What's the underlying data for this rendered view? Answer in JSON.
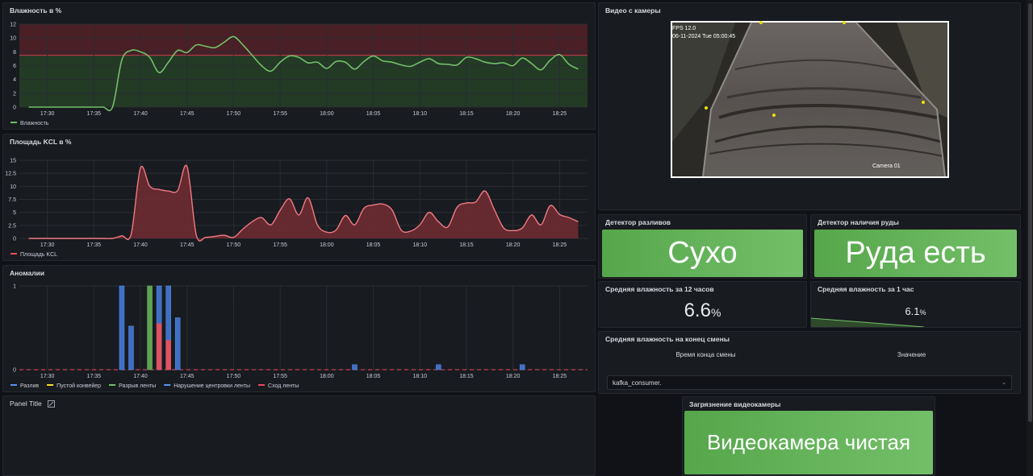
{
  "colors": {
    "bg": "#111217",
    "panel": "#181b1f",
    "green": "#73bf69",
    "red": "#f2495c",
    "blue": "#5794f2",
    "yellow": "#fade2a",
    "stat_bg": "#56a64b"
  },
  "humidity": {
    "title": "Влажность в %",
    "legend": "Влажность",
    "y_ticks": [
      "0",
      "2",
      "4",
      "6",
      "8",
      "10",
      "12"
    ],
    "x_ticks": [
      "17:30",
      "17:35",
      "17:40",
      "17:45",
      "17:50",
      "17:55",
      "18:00",
      "18:05",
      "18:10",
      "18:15",
      "18:20",
      "18:25"
    ]
  },
  "kcl": {
    "title": "Площадь KCL в %",
    "legend": "Площадь KCL",
    "y_ticks": [
      "0",
      "2.5",
      "5",
      "7.5",
      "10",
      "12.5",
      "15"
    ],
    "x_ticks": [
      "17:30",
      "17:35",
      "17:40",
      "17:45",
      "17:50",
      "17:55",
      "18:00",
      "18:05",
      "18:10",
      "18:15",
      "18:20",
      "18:25"
    ]
  },
  "anomalies": {
    "title": "Аномалии",
    "y_ticks": [
      "0",
      "1"
    ],
    "x_ticks": [
      "17:30",
      "17:35",
      "17:40",
      "17:45",
      "17:50",
      "17:55",
      "18:00",
      "18:05",
      "18:10",
      "18:15",
      "18:20",
      "18:25"
    ],
    "legend": [
      {
        "label": "Разлив",
        "color": "#5794f2"
      },
      {
        "label": "Пустой конвейер",
        "color": "#fade2a"
      },
      {
        "label": "Разрыв ленты",
        "color": "#73bf69"
      },
      {
        "label": "Нарушение центровки ленты",
        "color": "#5794f2"
      },
      {
        "label": "Сход ленты",
        "color": "#f2495c"
      }
    ]
  },
  "panel_title": {
    "title": "Panel Title"
  },
  "camera": {
    "title": "Видео с камеры",
    "osd_fps": "FPS 12.0",
    "osd_date": "06-11-2024 Tue 05:00:45",
    "osd_cam": "Camera 01"
  },
  "spill": {
    "title": "Детектор разливов",
    "value": "Сухо"
  },
  "ore": {
    "title": "Детектор наличия руды",
    "value": "Руда есть"
  },
  "avg12": {
    "title": "Средняя влажность за 12 часов",
    "value": "6.6",
    "unit": "%"
  },
  "avg1": {
    "title": "Средняя влажность за 1 час",
    "value": "6.1",
    "unit": "%"
  },
  "shift": {
    "title": "Средняя влажность на конец смены",
    "col_time": "Время конца смены",
    "col_value": "Значение",
    "select_value": "kafka_consumer."
  },
  "cam_dirt": {
    "title": "Загрязнение видеокамеры",
    "value": "Видеокамера чистая"
  },
  "chart_data": [
    {
      "type": "area",
      "title": "Влажность в %",
      "ylim": [
        0,
        12
      ],
      "x": [
        "17:28",
        "17:29",
        "17:30",
        "17:31",
        "17:32",
        "17:33",
        "17:34",
        "17:35",
        "17:36",
        "17:37",
        "17:38",
        "17:39",
        "17:40",
        "17:41",
        "17:42",
        "17:43",
        "17:44",
        "17:45",
        "17:46",
        "17:47",
        "17:48",
        "17:49",
        "17:50",
        "17:51",
        "17:52",
        "17:53",
        "17:54",
        "17:55",
        "17:56",
        "17:57",
        "17:58",
        "17:59",
        "18:00",
        "18:01",
        "18:02",
        "18:03",
        "18:04",
        "18:05",
        "18:06",
        "18:07",
        "18:08",
        "18:09",
        "18:10",
        "18:11",
        "18:12",
        "18:13",
        "18:14",
        "18:15",
        "18:16",
        "18:17",
        "18:18",
        "18:19",
        "18:20",
        "18:21",
        "18:22",
        "18:23",
        "18:24",
        "18:25",
        "18:26",
        "18:27"
      ],
      "series": [
        {
          "name": "Влажность",
          "values": [
            0,
            0,
            0,
            0,
            0,
            0,
            0,
            0,
            0,
            0,
            6.8,
            8.2,
            8.0,
            7.2,
            5.0,
            6.5,
            8.2,
            7.9,
            9.0,
            8.8,
            8.6,
            9.4,
            10.2,
            9.0,
            7.5,
            6.0,
            5.2,
            6.5,
            7.4,
            7.2,
            6.4,
            6.5,
            5.6,
            6.6,
            6.5,
            5.5,
            6.6,
            7.4,
            6.7,
            6.5,
            6.1,
            5.9,
            6.5,
            7.0,
            6.3,
            6.2,
            6.1,
            7.2,
            7.0,
            6.5,
            6.3,
            6.4,
            6.0,
            7.1,
            6.3,
            5.4,
            6.8,
            7.6,
            6.2,
            5.5
          ]
        }
      ],
      "threshold_ranges": [
        {
          "from": 0,
          "to": 7.5,
          "color": "green"
        },
        {
          "from": 7.5,
          "to": 12,
          "color": "red"
        }
      ]
    },
    {
      "type": "area",
      "title": "Площадь KCL в %",
      "ylim": [
        0,
        15
      ],
      "x": [
        "17:28",
        "17:29",
        "17:30",
        "17:31",
        "17:32",
        "17:33",
        "17:34",
        "17:35",
        "17:36",
        "17:37",
        "17:38",
        "17:39",
        "17:40",
        "17:41",
        "17:42",
        "17:43",
        "17:44",
        "17:45",
        "17:46",
        "17:47",
        "17:48",
        "17:49",
        "17:50",
        "17:51",
        "17:52",
        "17:53",
        "17:54",
        "17:55",
        "17:56",
        "17:57",
        "17:58",
        "17:59",
        "18:00",
        "18:01",
        "18:02",
        "18:03",
        "18:04",
        "18:05",
        "18:06",
        "18:07",
        "18:08",
        "18:09",
        "18:10",
        "18:11",
        "18:12",
        "18:13",
        "18:14",
        "18:15",
        "18:16",
        "18:17",
        "18:18",
        "18:19",
        "18:20",
        "18:21",
        "18:22",
        "18:23",
        "18:24",
        "18:25",
        "18:26",
        "18:27"
      ],
      "series": [
        {
          "name": "Площадь KCL",
          "values": [
            0,
            0,
            0,
            0,
            0,
            0,
            0,
            0,
            0,
            0,
            0.5,
            0.8,
            13.5,
            10.0,
            9.4,
            9.1,
            9.2,
            13.8,
            0.6,
            0.2,
            0.4,
            0.6,
            0.2,
            1.8,
            3.2,
            4.0,
            2.6,
            5.4,
            7.6,
            4.5,
            7.8,
            2.6,
            1.2,
            1.6,
            4.4,
            2.6,
            5.8,
            6.4,
            6.6,
            5.5,
            1.6,
            1.4,
            2.6,
            5.0,
            3.2,
            2.2,
            6.0,
            6.8,
            7.0,
            9.1,
            5.5,
            2.0,
            1.5,
            2.0,
            4.5,
            2.6,
            6.3,
            4.6,
            4.0,
            3.2
          ]
        }
      ]
    },
    {
      "type": "bar",
      "title": "Аномалии",
      "ylim": [
        0,
        1
      ],
      "series": [
        {
          "name": "Разлив",
          "points": [
            {
              "x": "17:38",
              "y": 1
            },
            {
              "x": "17:39",
              "y": 0.52
            },
            {
              "x": "17:41",
              "y": 1
            },
            {
              "x": "17:42",
              "y": 1
            },
            {
              "x": "17:43",
              "y": 1
            },
            {
              "x": "17:44",
              "y": 0.62
            },
            {
              "x": "18:03",
              "y": 0.06
            },
            {
              "x": "18:12",
              "y": 0.06
            },
            {
              "x": "18:21",
              "y": 0.06
            }
          ]
        },
        {
          "name": "Разрыв ленты",
          "points": [
            {
              "x": "17:41",
              "y": 1
            }
          ]
        },
        {
          "name": "Сход ленты",
          "points": [
            {
              "x": "17:42",
              "y": 0.55
            },
            {
              "x": "17:43",
              "y": 0.35
            }
          ]
        }
      ]
    }
  ]
}
